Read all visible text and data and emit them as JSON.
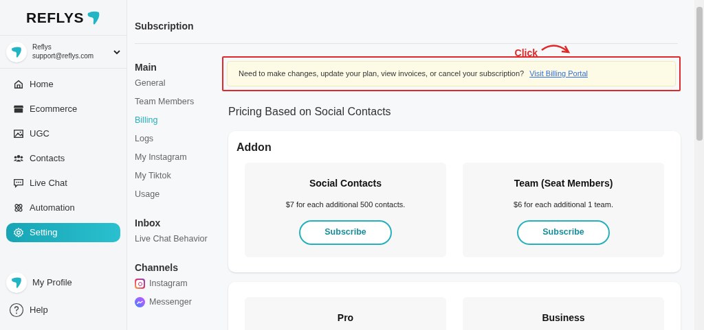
{
  "brand": {
    "name": "REFLYS"
  },
  "account": {
    "name": "Reflys",
    "email": "support@reflys.com"
  },
  "nav": [
    {
      "label": "Home",
      "selected": false
    },
    {
      "label": "Ecommerce",
      "selected": false
    },
    {
      "label": "UGC",
      "selected": false
    },
    {
      "label": "Contacts",
      "selected": false
    },
    {
      "label": "Live Chat",
      "selected": false
    },
    {
      "label": "Automation",
      "selected": false
    },
    {
      "label": "Setting",
      "selected": true
    }
  ],
  "bottom_nav": [
    {
      "label": "My Profile",
      "kind": "avatar"
    },
    {
      "label": "Help",
      "kind": "help"
    }
  ],
  "page_title": "Subscription",
  "settings_sections": [
    {
      "title": "Main",
      "items": [
        {
          "label": "General",
          "selected": false
        },
        {
          "label": "Team Members",
          "selected": false
        },
        {
          "label": "Billing",
          "selected": true
        },
        {
          "label": "Logs",
          "selected": false
        },
        {
          "label": "My Instagram",
          "selected": false
        },
        {
          "label": "My Tiktok",
          "selected": false
        },
        {
          "label": "Usage",
          "selected": false
        }
      ]
    },
    {
      "title": "Inbox",
      "items": [
        {
          "label": "Live Chat Behavior",
          "selected": false
        }
      ]
    },
    {
      "title": "Channels",
      "items": [
        {
          "label": "Instagram",
          "selected": false
        },
        {
          "label": "Messenger",
          "selected": false
        }
      ]
    }
  ],
  "annotation": {
    "label": "Click"
  },
  "notice": {
    "text": "Need to make changes, update your plan, view invoices, or cancel your subscription?",
    "link": "Visit Billing Portal"
  },
  "pricing_title": "Pricing Based on Social Contacts",
  "cards": [
    {
      "title": "Addon",
      "plans": [
        {
          "name": "Social Contacts",
          "description": "$7 for each additional 500 contacts.",
          "button": "Subscribe"
        },
        {
          "name": "Team (Seat Members)",
          "description": "$6 for each additional 1 team.",
          "button": "Subscribe"
        }
      ]
    },
    {
      "plans": [
        {
          "name": "Pro"
        },
        {
          "name": "Business"
        }
      ]
    }
  ]
}
